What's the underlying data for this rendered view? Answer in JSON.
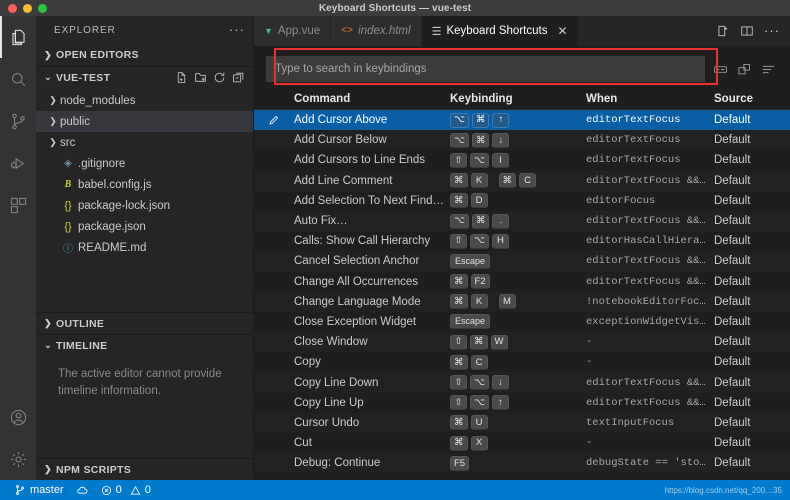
{
  "window": {
    "title": "Keyboard Shortcuts — vue-test",
    "traffic_lights": [
      "close",
      "minimize",
      "zoom"
    ]
  },
  "activity_bar": {
    "items": [
      {
        "name": "explorer",
        "icon": "files-icon",
        "active": true
      },
      {
        "name": "search",
        "icon": "search-icon",
        "active": false
      },
      {
        "name": "source-control",
        "icon": "source-control-icon",
        "active": false
      },
      {
        "name": "run-and-debug",
        "icon": "run-debug-icon",
        "active": false
      },
      {
        "name": "extensions",
        "icon": "extensions-icon",
        "active": false
      }
    ],
    "bottom_items": [
      {
        "name": "accounts",
        "icon": "account-icon"
      },
      {
        "name": "manage",
        "icon": "gear-icon"
      }
    ]
  },
  "sidebar": {
    "title": "EXPLORER",
    "more_actions": "···",
    "sections": [
      {
        "label": "OPEN EDITORS",
        "expanded": false
      },
      {
        "label": "VUE-TEST",
        "expanded": true
      },
      {
        "label": "OUTLINE",
        "expanded": false
      },
      {
        "label": "TIMELINE",
        "expanded": true
      },
      {
        "label": "NPM SCRIPTS",
        "expanded": false
      }
    ],
    "explorer_actions": [
      "new-file-icon",
      "new-folder-icon",
      "refresh-icon",
      "collapse-all-icon"
    ],
    "files": [
      {
        "label": "node_modules",
        "type": "folder",
        "icon": "folder-icon",
        "selected": false
      },
      {
        "label": "public",
        "type": "folder",
        "icon": "folder-icon",
        "selected": true
      },
      {
        "label": "src",
        "type": "folder",
        "icon": "folder-icon",
        "selected": false
      },
      {
        "label": ".gitignore",
        "type": "file",
        "icon": "gitignore-icon",
        "selected": false
      },
      {
        "label": "babel.config.js",
        "type": "file",
        "icon": "babel-icon",
        "selected": false
      },
      {
        "label": "package-lock.json",
        "type": "file",
        "icon": "json-icon",
        "selected": false
      },
      {
        "label": "package.json",
        "type": "file",
        "icon": "json-icon",
        "selected": false
      },
      {
        "label": "README.md",
        "type": "file",
        "icon": "markdown-icon",
        "selected": false
      }
    ],
    "timeline_message": "The active editor cannot provide timeline information."
  },
  "tabs": [
    {
      "label": "App.vue",
      "icon": "vue-icon",
      "active": false,
      "italic": false,
      "closable": false
    },
    {
      "label": "index.html",
      "icon": "html-icon",
      "active": false,
      "italic": true,
      "closable": false
    },
    {
      "label": "Keyboard Shortcuts",
      "icon": "keyboard-shortcuts-icon",
      "active": true,
      "italic": false,
      "closable": true
    }
  ],
  "tabbar_actions": [
    "split-editor-right-icon",
    "split-editor-layout-icon",
    "more-actions-icon"
  ],
  "search": {
    "placeholder": "Type to search in keybindings",
    "value": "",
    "highlight_color": "#e8322c"
  },
  "editor_actions": [
    "record-keys-icon",
    "sort-by-precedence-icon",
    "clear-keybindings-search-icon"
  ],
  "table": {
    "columns": [
      "Command",
      "Keybinding",
      "When",
      "Source"
    ],
    "rows": [
      {
        "command": "Add Cursor Above",
        "keys": [
          "⌥",
          "⌘",
          "↑"
        ],
        "when": "editorTextFocus",
        "source": "Default",
        "selected": true
      },
      {
        "command": "Add Cursor Below",
        "keys": [
          "⌥",
          "⌘",
          "↓"
        ],
        "when": "editorTextFocus",
        "source": "Default",
        "selected": false
      },
      {
        "command": "Add Cursors to Line Ends",
        "keys": [
          "⇧",
          "⌥",
          "I"
        ],
        "when": "editorTextFocus",
        "source": "Default",
        "selected": false
      },
      {
        "command": "Add Line Comment",
        "keys": [
          "⌘",
          "K",
          "",
          "⌘",
          "C"
        ],
        "when": "editorTextFocus &&…",
        "source": "Default",
        "selected": false
      },
      {
        "command": "Add Selection To Next Find…",
        "keys": [
          "⌘",
          "D"
        ],
        "when": "editorFocus",
        "source": "Default",
        "selected": false
      },
      {
        "command": "Auto Fix…",
        "keys": [
          "⌥",
          "⌘",
          "."
        ],
        "when": "editorTextFocus &&…",
        "source": "Default",
        "selected": false
      },
      {
        "command": "Calls: Show Call Hierarchy",
        "keys": [
          "⇧",
          "⌥",
          "H"
        ],
        "when": "editorHasCallHiera…",
        "source": "Default",
        "selected": false
      },
      {
        "command": "Cancel Selection Anchor",
        "keys": [
          "Escape"
        ],
        "when": "editorTextFocus &&…",
        "source": "Default",
        "selected": false
      },
      {
        "command": "Change All Occurrences",
        "keys": [
          "⌘",
          "F2"
        ],
        "when": "editorTextFocus &&…",
        "source": "Default",
        "selected": false
      },
      {
        "command": "Change Language Mode",
        "keys": [
          "⌘",
          "K",
          "",
          "M"
        ],
        "when": "!notebookEditorFoc…",
        "source": "Default",
        "selected": false
      },
      {
        "command": "Close Exception Widget",
        "keys": [
          "Escape"
        ],
        "when": "exceptionWidgetVis…",
        "source": "Default",
        "selected": false
      },
      {
        "command": "Close Window",
        "keys": [
          "⇧",
          "⌘",
          "W"
        ],
        "when": "-",
        "source": "Default",
        "selected": false
      },
      {
        "command": "Copy",
        "keys": [
          "⌘",
          "C"
        ],
        "when": "-",
        "source": "Default",
        "selected": false
      },
      {
        "command": "Copy Line Down",
        "keys": [
          "⇧",
          "⌥",
          "↓"
        ],
        "when": "editorTextFocus &&…",
        "source": "Default",
        "selected": false
      },
      {
        "command": "Copy Line Up",
        "keys": [
          "⇧",
          "⌥",
          "↑"
        ],
        "when": "editorTextFocus &&…",
        "source": "Default",
        "selected": false
      },
      {
        "command": "Cursor Undo",
        "keys": [
          "⌘",
          "U"
        ],
        "when": "textInputFocus",
        "source": "Default",
        "selected": false
      },
      {
        "command": "Cut",
        "keys": [
          "⌘",
          "X"
        ],
        "when": "-",
        "source": "Default",
        "selected": false
      },
      {
        "command": "Debug: Continue",
        "keys": [
          "F5"
        ],
        "when": "debugState == 'sto…",
        "source": "Default",
        "selected": false
      }
    ]
  },
  "status_bar": {
    "branch": "master",
    "sync_icon": "cloud-sync-icon",
    "errors": "0",
    "warnings": "0",
    "watermark": "https://blog.csdn.net/qq_200…35"
  }
}
